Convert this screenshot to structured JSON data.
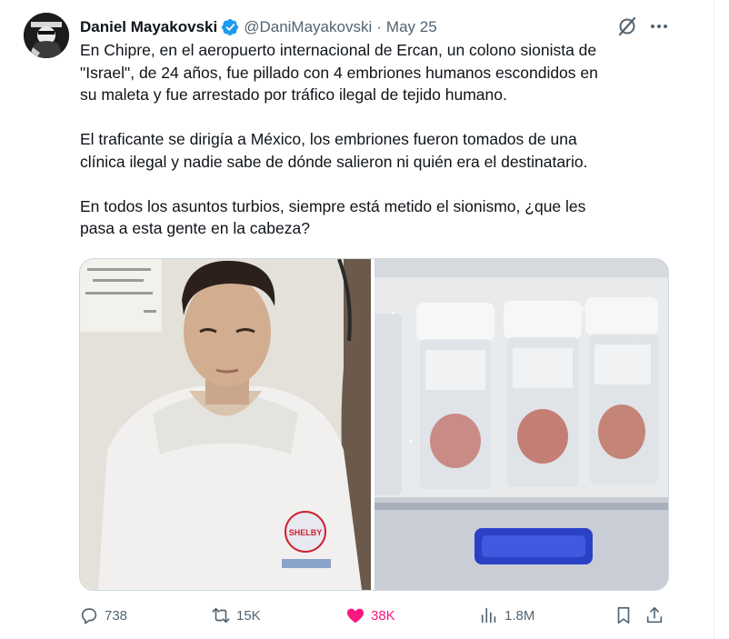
{
  "tweet": {
    "display_name": "Daniel Mayakovski",
    "handle": "@DaniMayakovski",
    "separator": "·",
    "date": "May 25",
    "paragraphs": [
      "En Chipre, en el aeropuerto internacional de Ercan, un colono sionista de\n\"Israel\", de 24 años, fue pillado con 4 embriones humanos escondidos en\nsu maleta y fue arrestado por tráfico ilegal de tejido humano.",
      "El traficante se dirigía a México, los embriones fueron tomados de una\nclínica ilegal y nadie sabe de dónde salieron ni quién era el destinatario.",
      "En todos los asuntos turbios, siempre está metido el sionismo, ¿que les\npasa a esta gente en la cabeza?"
    ],
    "hoodie_logo_text": "SHELBY",
    "stats": {
      "replies": "738",
      "reposts": "15K",
      "likes": "38K",
      "views": "1.8M"
    }
  },
  "colors": {
    "verified": "#1d9bf0",
    "like": "#f91880",
    "muted": "#536471"
  },
  "icons": {
    "verified": "verified-badge-icon",
    "grok": "grok-icon",
    "more": "more-icon",
    "reply": "reply-icon",
    "repost": "repost-icon",
    "like": "heart-icon",
    "views": "views-icon",
    "bookmark": "bookmark-icon",
    "share": "share-icon"
  }
}
